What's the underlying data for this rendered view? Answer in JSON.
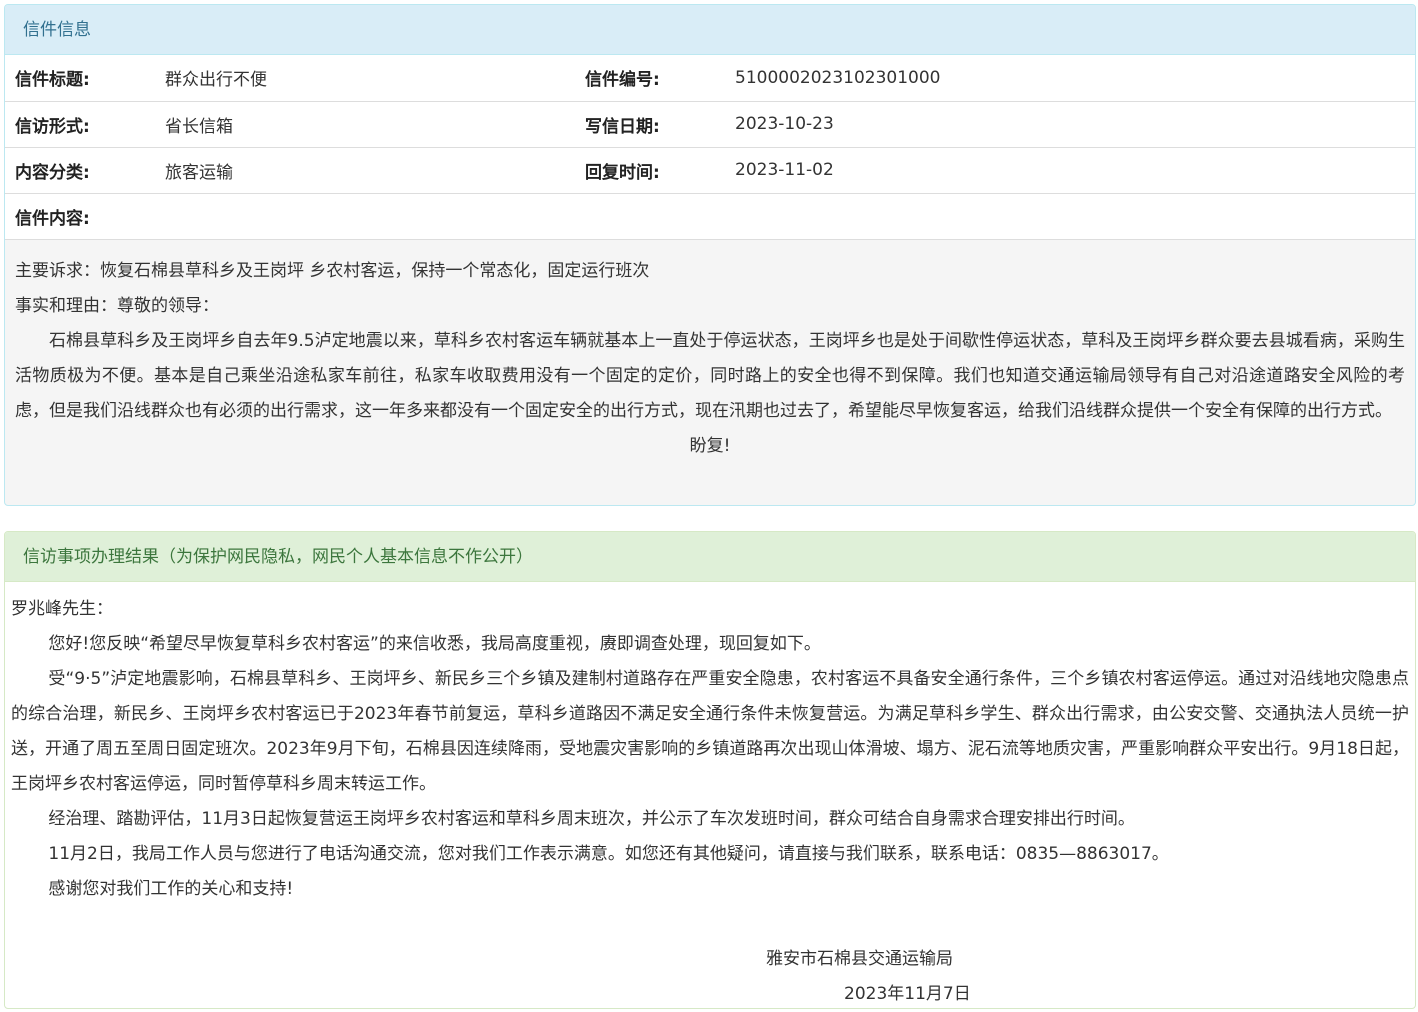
{
  "letter_panel": {
    "heading": "信件信息",
    "rows": [
      {
        "l1": "信件标题:",
        "v1": "群众出行不便",
        "l2": "信件编号:",
        "v2": "510000202310230100​0"
      },
      {
        "l1": "信访形式:",
        "v1": "省长信箱",
        "l2": "写信日期:",
        "v2": "2023-10-23"
      },
      {
        "l1": "内容分类:",
        "v1": "旅客运输",
        "l2": "回复时间:",
        "v2": "2023-11-02"
      }
    ],
    "content_label": "信件内容:",
    "content": {
      "line1": "主要诉求：恢复石棉县草科乡及王岗坪 乡农村客运，保持一个常态化，固定运行班次",
      "line2": "事实和理由：尊敬的领导：",
      "body": "石棉县草科乡及王岗坪乡自去年9.5泸定地震以来，草科乡农村客运车辆就基本上一直处于停运状态，王岗坪乡也是处于间歇性停运状态，草科及王岗坪乡群众要去县城看病，采购生活物质极为不便。基本是自己乘坐沿途私家车前往，私家车收取费用没有一个固定的定价，同时路上的安全也得不到保障。我们也知道交通运输局领导有自己对沿途道路安全风险的考虑，但是我们沿线群众也有必须的出行需求，这一年多来都没有一个固定安全的出行方式，现在汛期也过去了，希望能尽早恢复客运，给我们沿线群众提供一个安全有保障的出行方式。",
      "closing": "盼复!"
    }
  },
  "result_panel": {
    "heading": "信访事项办理结果（为保护网民隐私，网民个人基本信息不作公开）",
    "salutation": "罗兆峰先生：",
    "paragraphs": [
      "您好!您反映“希望尽早恢复草科乡农村客运”的来信收悉，我局高度重视，赓即调查处理，现回复如下。",
      "受“9·5”泸定地震影响，石棉县草科乡、王岗坪乡、新民乡三个乡镇及建制村道路存在严重安全隐患，农村客运不具备安全通行条件，三个乡镇农村客运停运。通过对沿线地灾隐患点的综合治理，新民乡、王岗坪乡农村客运已于2023年春节前复运，草科乡道路因不满足安全通行条件未恢复营运。为满足草科乡学生、群众出行需求，由公安交警、交通执法人员统一护送，开通了周五至周日固定班次。2023年9月下旬，石棉县因连续降雨，受地震灾害影响的乡镇道路再次出现山体滑坡、塌方、泥石流等地质灾害，严重影响群众平安出行。9月18日起，王岗坪乡农村客运停运，同时暂停草科乡周末转运工作。",
      "经治理、踏勘评估，11月3日起恢复营运王岗坪乡农村客运和草科乡周末班次，并公示了车次发班时间，群众可结合自身需求合理安排出行时间。",
      "11月2日，我局工作人员与您进行了电话沟通交流，您对我们工作表示满意。如您还有其他疑问，请直接与我们联系，联系电话：0835—8863017。",
      "感谢您对我们工作的关心和支持!"
    ],
    "signature": "雅安市石棉县交通运输局",
    "date": "2023年11月7日"
  }
}
